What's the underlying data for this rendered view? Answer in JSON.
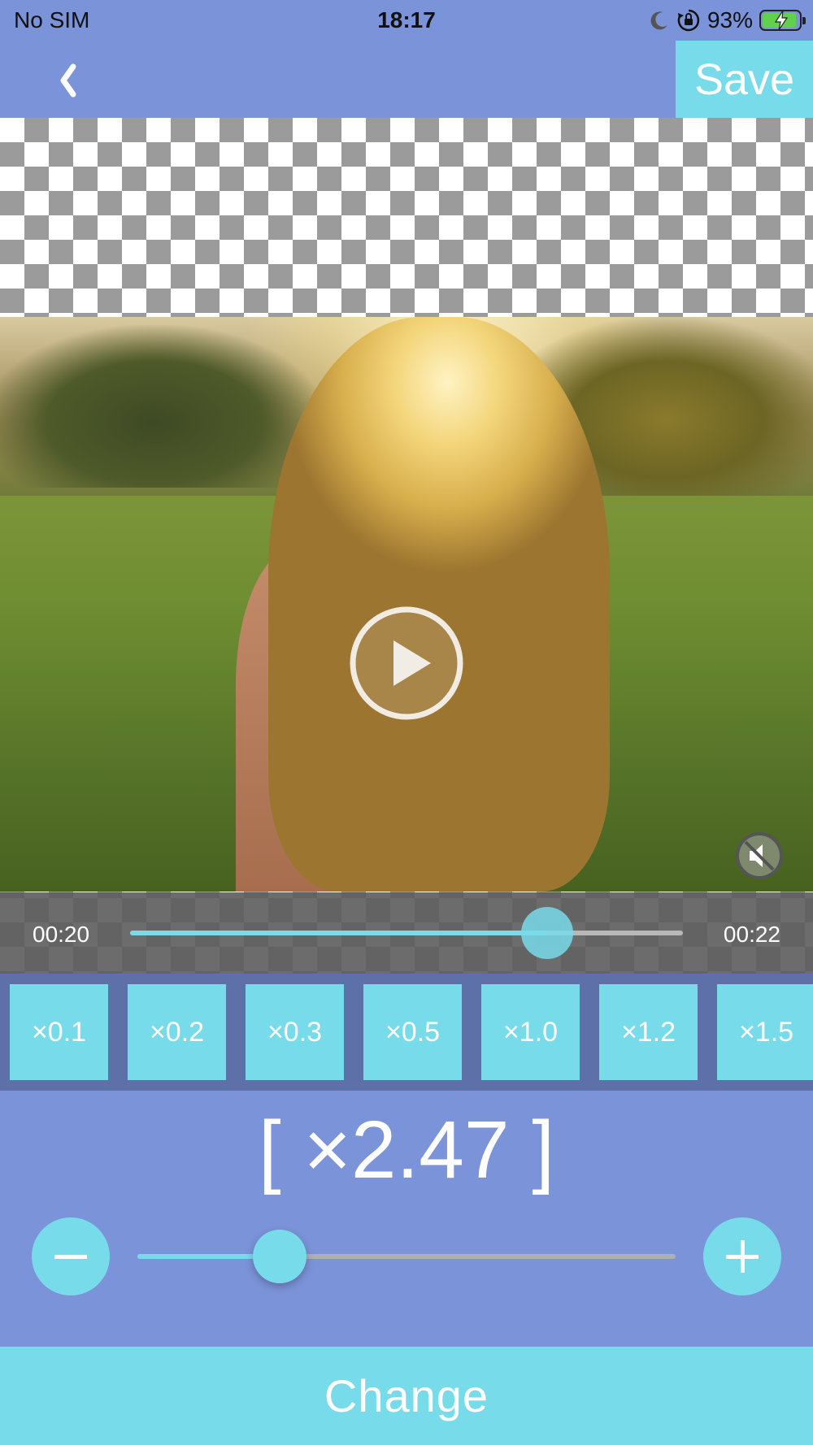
{
  "status_bar": {
    "carrier": "No SIM",
    "time": "18:17",
    "battery_percent": "93%",
    "battery_level": 0.93,
    "icons": [
      "moon-icon",
      "orientation-lock-icon",
      "battery-charging-icon"
    ]
  },
  "header": {
    "back_icon": "chevron-left-icon",
    "save_label": "Save"
  },
  "player": {
    "play_icon": "play-icon",
    "mute_icon": "speaker-muted-icon",
    "current_time": "00:20",
    "end_time": "00:22",
    "progress": 0.755
  },
  "speed_presets": [
    "×0.1",
    "×0.2",
    "×0.3",
    "×0.5",
    "×1.0",
    "×1.2",
    "×1.5"
  ],
  "speed": {
    "value_label": "[ ×2.47 ]",
    "slider_position": 0.264,
    "minus_icon": "minus-icon",
    "plus_icon": "plus-icon"
  },
  "footer": {
    "change_label": "Change"
  },
  "colors": {
    "background": "#7b93d8",
    "accent": "#78dbea",
    "preset_bar": "#5e70a8"
  }
}
